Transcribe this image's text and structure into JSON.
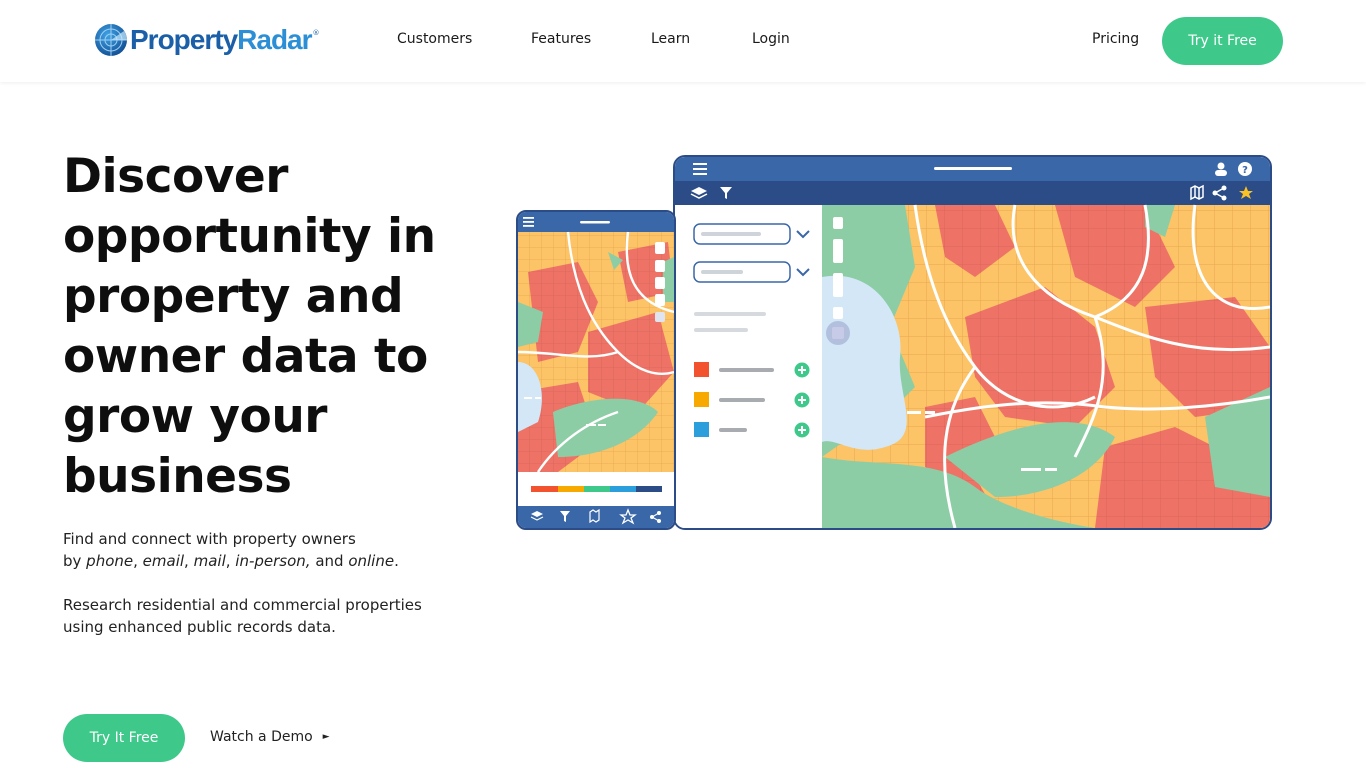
{
  "nav": {
    "logo_text_a": "Property",
    "logo_text_b": "Radar",
    "logo_reg": "®",
    "links": [
      "Customers",
      "Features",
      "Learn",
      "Login"
    ],
    "pricing": "Pricing",
    "cta": "Try it Free"
  },
  "hero": {
    "title": "Discover opportunity in property and owner data to grow your business",
    "p1_line1": "Find and connect with property owners",
    "p1_line2": {
      "by": "by ",
      "phone": "phone",
      "sep1": ", ",
      "email": "email",
      "sep2": ", ",
      "mail": "mail",
      "sep3": ", ",
      "inperson": "in-person,",
      "and": " and ",
      "online": "online",
      "end": "."
    },
    "p2": "Research residential and commercial properties using enhanced public records data.",
    "cta": "Try It Free",
    "demo": "Watch a Demo",
    "demo_arrow": "►"
  },
  "colors": {
    "accent_green": "#3ec98b",
    "nav_blue": "#2b4c86",
    "map_red": "#ee7366",
    "map_yellow": "#fcc466",
    "map_green": "#8ccda6",
    "map_water": "#d3e7f6",
    "legend_red": "#f2532e",
    "legend_orange": "#f7a900",
    "legend_blue": "#2a9fdc"
  },
  "icons": {
    "menu": "hamburger-menu-icon",
    "user": "user-icon",
    "help": "question-icon",
    "layers": "layers-icon",
    "filter": "filter-icon",
    "map": "map-icon",
    "share": "share-icon",
    "star": "star-icon",
    "chevron": "chevron-down-icon",
    "add": "plus-circle-icon"
  }
}
